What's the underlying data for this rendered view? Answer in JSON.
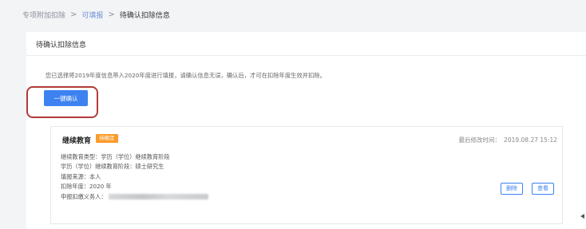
{
  "breadcrumb": {
    "items": [
      "专项附加扣除",
      "可填报",
      "待确认扣除信息"
    ],
    "separator": ">"
  },
  "panel": {
    "title": "待确认扣除信息",
    "notice": "您已选择将2019年度信息带入2020年度进行填报，请确认信息无误，确认后，才可在扣除年度生效并扣除。",
    "confirm_button": "一键确认"
  },
  "card": {
    "title": "继续教育",
    "status_tag": "待确定",
    "modified_label": "最后修改时间：",
    "modified_value": "2019.08.27 15:12",
    "fields": [
      {
        "label": "继续教育类型：",
        "value": "学历（学位）继续教育阶段"
      },
      {
        "label": "学历（学位）继续教育阶段：",
        "value": "硕士研究生"
      },
      {
        "label": "填报来源：",
        "value": "本人"
      },
      {
        "label": "扣除年度：",
        "value": "2020 年"
      },
      {
        "label": "申报扣缴义务人：",
        "value": ""
      }
    ],
    "delete_label": "删除",
    "view_label": "查看"
  },
  "colors": {
    "primary": "#3d82f0",
    "tag": "#fa9b2a",
    "highlight": "#b23a3a"
  }
}
